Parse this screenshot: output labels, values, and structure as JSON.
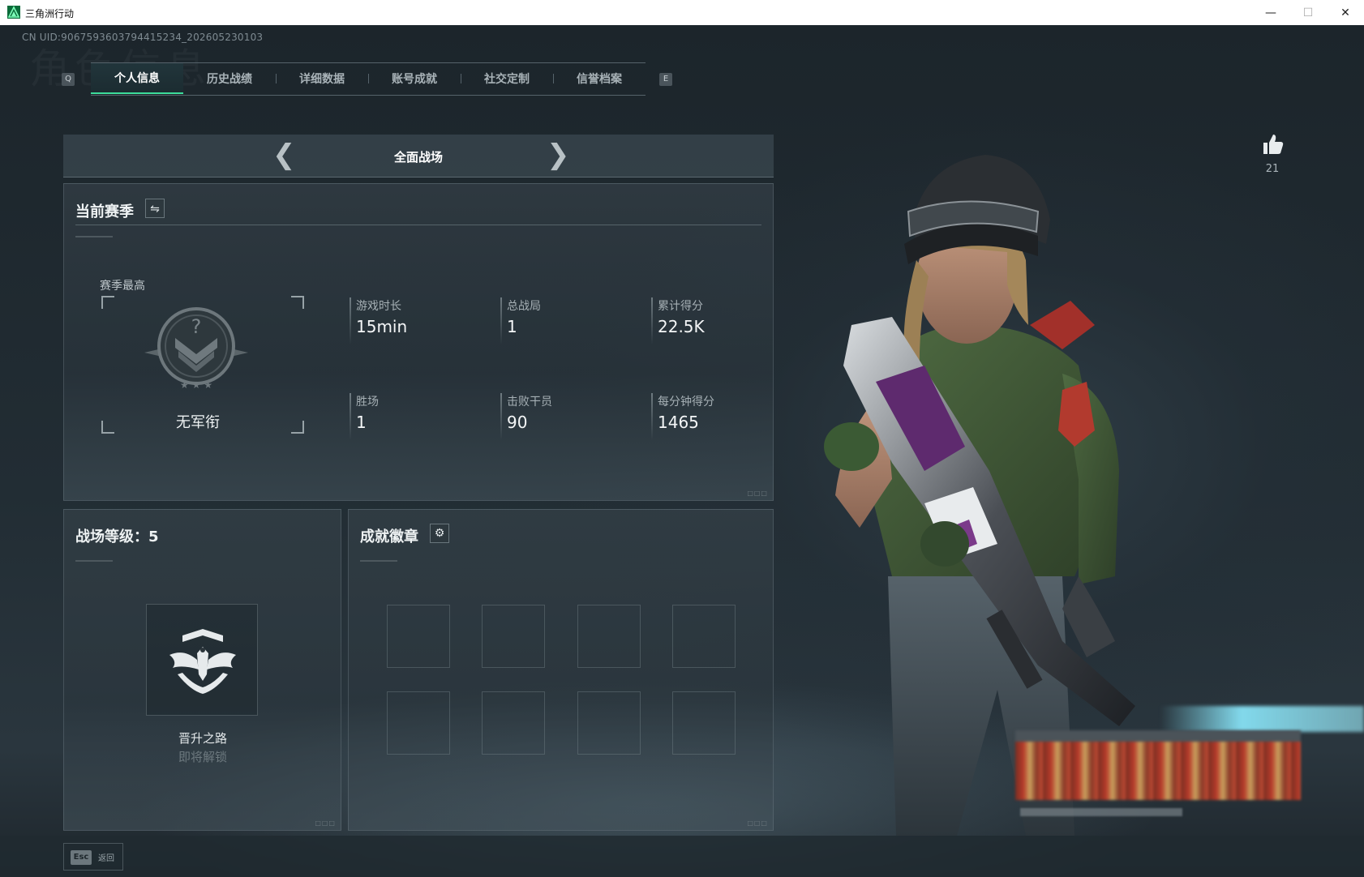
{
  "window": {
    "title": "三角洲行动"
  },
  "header": {
    "uid_text": "CN UID:9067593603794415234_202605230103",
    "ghost_title": "角色信息"
  },
  "tabs": {
    "prev_key": "Q",
    "next_key": "E",
    "items": [
      {
        "label": "个人信息",
        "active": true
      },
      {
        "label": "历史战绩"
      },
      {
        "label": "详细数据"
      },
      {
        "label": "账号成就"
      },
      {
        "label": "社交定制"
      },
      {
        "label": "信誉档案"
      }
    ]
  },
  "mode_selector": {
    "label": "全面战场"
  },
  "season": {
    "title": "当前赛季",
    "best_label": "赛季最高",
    "rank_name": "无军衔",
    "stats": [
      {
        "label": "游戏时长",
        "value": "15min"
      },
      {
        "label": "总战局",
        "value": "1"
      },
      {
        "label": "累计得分",
        "value": "22.5K"
      },
      {
        "label": "胜场",
        "value": "1"
      },
      {
        "label": "击败干员",
        "value": "90"
      },
      {
        "label": "每分钟得分",
        "value": "1465"
      }
    ]
  },
  "level": {
    "title": "战场等级：5",
    "path_name": "晋升之路",
    "path_status": "即将解锁"
  },
  "badges": {
    "title": "成就徽章",
    "slots": 8
  },
  "like": {
    "count": "21"
  },
  "bottom": {
    "esc_key": "Esc",
    "back_label": "返回"
  },
  "colors": {
    "accent": "#3ddc9b",
    "panel_border": "#56636b"
  },
  "icons": [
    "app-icon",
    "swap-icon",
    "gear-icon",
    "thumbs-up-icon",
    "chevron-left-icon",
    "chevron-right-icon",
    "rank-emblem-icon",
    "eagle-emblem-icon"
  ]
}
